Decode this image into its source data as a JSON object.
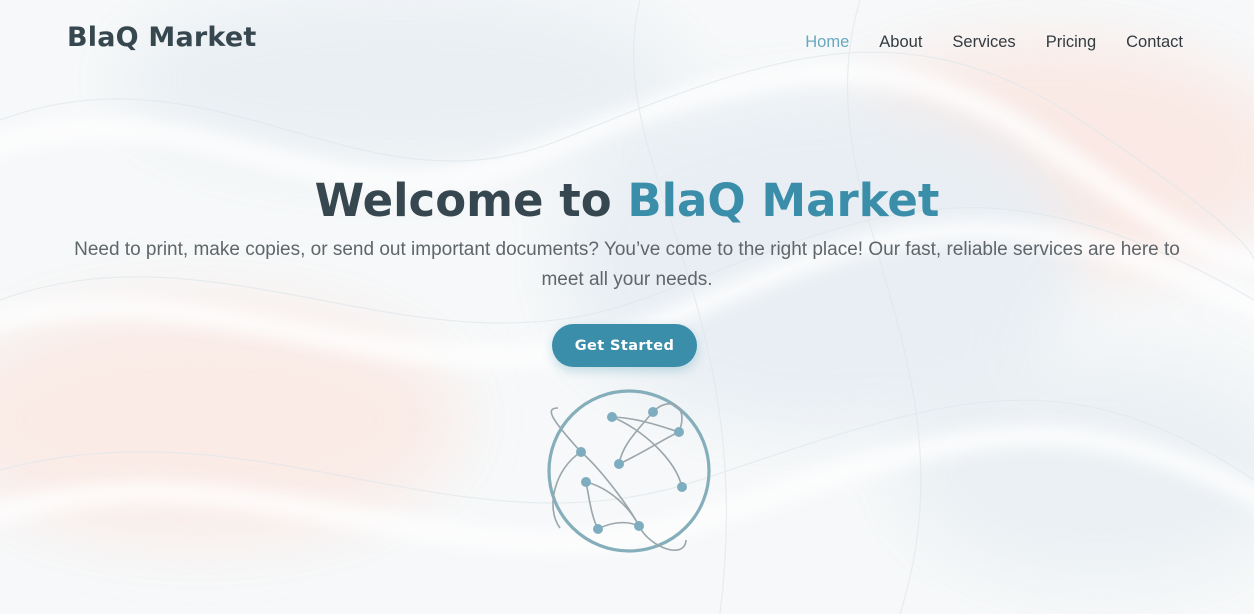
{
  "brand": {
    "name": "BlaQ Market"
  },
  "nav": {
    "items": [
      {
        "label": "Home",
        "active": true
      },
      {
        "label": "About",
        "active": false
      },
      {
        "label": "Services",
        "active": false
      },
      {
        "label": "Pricing",
        "active": false
      },
      {
        "label": "Contact",
        "active": false
      }
    ]
  },
  "hero": {
    "title_prefix": "Welcome to ",
    "title_accent": "BlaQ Market",
    "subtitle": "Need to print, make copies, or send out important documents? You’ve come to the right place! Our fast, reliable services are here to meet all your needs.",
    "cta_label": "Get Started",
    "illustration_icon": "network-globe-icon"
  },
  "colors": {
    "accent": "#3a8ea9",
    "nav_active": "#6aa8c2",
    "text_dark": "#37474f",
    "text_muted": "#5f666a",
    "button": "#3b8eaa"
  }
}
